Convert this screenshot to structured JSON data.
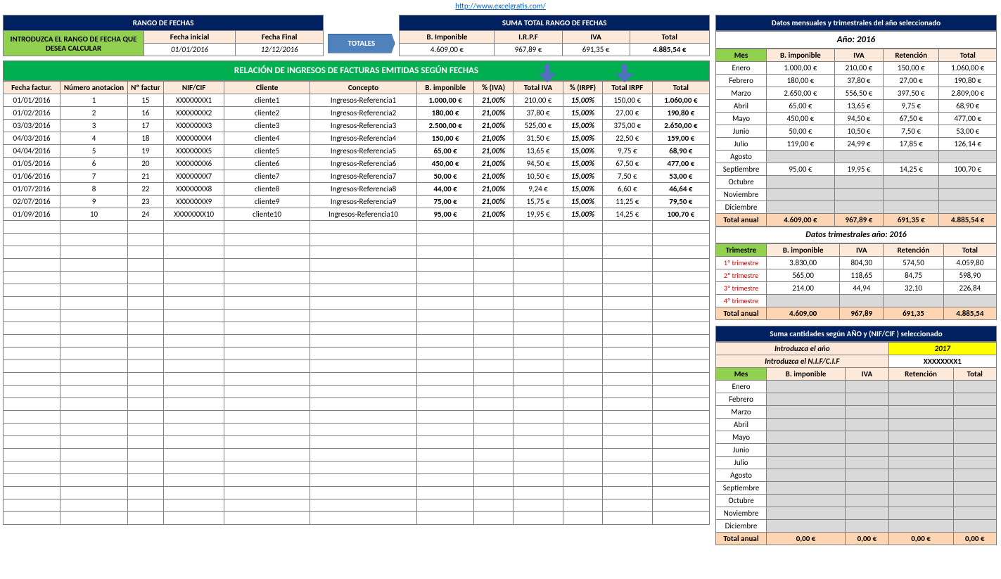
{
  "link": "http://www.excelgratis.com/",
  "rango_header": "RANGO DE FECHAS",
  "rango_instruct": "INTRODUZCA EL RANGO DE FECHA QUE DESEA CALCULAR",
  "fecha_inicial_lbl": "Fecha inicial",
  "fecha_final_lbl": "Fecha Final",
  "fecha_inicial": "01/01/2016",
  "fecha_final": "12/12/2016",
  "totales_lbl": "TOTALES",
  "suma_header": "SUMA TOTAL RANGO DE FECHAS",
  "suma_cols": [
    "B. Imponible",
    "I.R.P.F",
    "IVA",
    "Total"
  ],
  "suma_vals": [
    "4.609,00 €",
    "967,89 €",
    "691,35 €",
    "4.885,54 €"
  ],
  "relacion_title": "RELACIÓN DE INGRESOS  DE FACTURAS EMITIDAS SEGÚN FECHAS",
  "main_cols": [
    "Fecha factur.",
    "Número anotacion",
    "Nº factur",
    "NIF/CIF",
    "Cliente",
    "Concepto",
    "B. imponible",
    "% (IVA)",
    "Total IVA",
    "% (IRPF)",
    "Total IRPF",
    "Total"
  ],
  "rows": [
    {
      "f": "01/01/2016",
      "n": "1",
      "nf": "15",
      "nif": "XXXXXXXX1",
      "cl": "cliente1",
      "co": "Ingresos-Referencia1",
      "bi": "1.000,00 €",
      "pv": "21,00%",
      "tv": "210,00 €",
      "pi": "15,00%",
      "ti": "150,00 €",
      "t": "1.060,00 €"
    },
    {
      "f": "01/02/2016",
      "n": "2",
      "nf": "16",
      "nif": "XXXXXXXX2",
      "cl": "cliente2",
      "co": "Ingresos-Referencia2",
      "bi": "180,00 €",
      "pv": "21,00%",
      "tv": "37,80 €",
      "pi": "15,00%",
      "ti": "27,00 €",
      "t": "190,80 €"
    },
    {
      "f": "03/03/2016",
      "n": "3",
      "nf": "17",
      "nif": "XXXXXXXX3",
      "cl": "cliente3",
      "co": "Ingresos-Referencia3",
      "bi": "2.500,00 €",
      "pv": "21,00%",
      "tv": "525,00 €",
      "pi": "15,00%",
      "ti": "375,00 €",
      "t": "2.650,00 €"
    },
    {
      "f": "04/03/2016",
      "n": "4",
      "nf": "18",
      "nif": "XXXXXXXX4",
      "cl": "cliente4",
      "co": "Ingresos-Referencia4",
      "bi": "150,00 €",
      "pv": "21,00%",
      "tv": "31,50 €",
      "pi": "15,00%",
      "ti": "22,50 €",
      "t": "159,00 €"
    },
    {
      "f": "04/04/2016",
      "n": "5",
      "nf": "19",
      "nif": "XXXXXXXX5",
      "cl": "cliente5",
      "co": "Ingresos-Referencia5",
      "bi": "65,00 €",
      "pv": "21,00%",
      "tv": "13,65 €",
      "pi": "15,00%",
      "ti": "9,75 €",
      "t": "68,90 €"
    },
    {
      "f": "01/05/2016",
      "n": "6",
      "nf": "20",
      "nif": "XXXXXXXX6",
      "cl": "cliente6",
      "co": "Ingresos-Referencia6",
      "bi": "450,00 €",
      "pv": "21,00%",
      "tv": "94,50 €",
      "pi": "15,00%",
      "ti": "67,50 €",
      "t": "477,00 €"
    },
    {
      "f": "01/06/2016",
      "n": "7",
      "nf": "21",
      "nif": "XXXXXXXX7",
      "cl": "cliente7",
      "co": "Ingresos-Referencia7",
      "bi": "50,00 €",
      "pv": "21,00%",
      "tv": "10,50 €",
      "pi": "15,00%",
      "ti": "7,50 €",
      "t": "53,00 €"
    },
    {
      "f": "01/07/2016",
      "n": "8",
      "nf": "22",
      "nif": "XXXXXXXX8",
      "cl": "cliente8",
      "co": "Ingresos-Referencia8",
      "bi": "44,00 €",
      "pv": "21,00%",
      "tv": "9,24 €",
      "pi": "15,00%",
      "ti": "6,60 €",
      "t": "46,64 €"
    },
    {
      "f": "02/07/2016",
      "n": "9",
      "nf": "23",
      "nif": "XXXXXXXX9",
      "cl": "cliente9",
      "co": "Ingresos-Referencia9",
      "bi": "75,00 €",
      "pv": "21,00%",
      "tv": "15,75 €",
      "pi": "15,00%",
      "ti": "11,25 €",
      "t": "79,50 €"
    },
    {
      "f": "01/09/2016",
      "n": "10",
      "nf": "24",
      "nif": "XXXXXXXX10",
      "cl": "cliente10",
      "co": "Ingresos-Referencia10",
      "bi": "95,00 €",
      "pv": "21,00%",
      "tv": "19,95 €",
      "pi": "15,00%",
      "ti": "14,25 €",
      "t": "100,70 €"
    }
  ],
  "empty_rows": 24,
  "monthly_header": "Datos mensuales  y trimestrales del año seleccionado",
  "year_lbl": "Año:  2016",
  "monthly_cols": [
    "Mes",
    "B. imponible",
    "IVA",
    "Retención",
    "Total"
  ],
  "months": [
    {
      "m": "Enero",
      "bi": "1.000,00 €",
      "iva": "210,00 €",
      "ret": "150,00 €",
      "t": "1.060,00 €"
    },
    {
      "m": "Febrero",
      "bi": "180,00 €",
      "iva": "37,80 €",
      "ret": "27,00 €",
      "t": "190,80 €"
    },
    {
      "m": "Marzo",
      "bi": "2.650,00 €",
      "iva": "556,50 €",
      "ret": "397,50 €",
      "t": "2.809,00 €"
    },
    {
      "m": "Abril",
      "bi": "65,00 €",
      "iva": "13,65 €",
      "ret": "9,75 €",
      "t": "68,90 €"
    },
    {
      "m": "Mayo",
      "bi": "450,00 €",
      "iva": "94,50 €",
      "ret": "67,50 €",
      "t": "477,00 €"
    },
    {
      "m": "Junio",
      "bi": "50,00 €",
      "iva": "10,50 €",
      "ret": "7,50 €",
      "t": "53,00 €"
    },
    {
      "m": "Julio",
      "bi": "119,00 €",
      "iva": "24,99 €",
      "ret": "17,85 €",
      "t": "126,14 €"
    },
    {
      "m": "Agosto",
      "bi": "",
      "iva": "",
      "ret": "",
      "t": ""
    },
    {
      "m": "Septiembre",
      "bi": "95,00 €",
      "iva": "19,95 €",
      "ret": "14,25 €",
      "t": "100,70 €"
    },
    {
      "m": "Octubre",
      "bi": "",
      "iva": "",
      "ret": "",
      "t": ""
    },
    {
      "m": "Noviembre",
      "bi": "",
      "iva": "",
      "ret": "",
      "t": ""
    },
    {
      "m": "Diciembre",
      "bi": "",
      "iva": "",
      "ret": "",
      "t": ""
    }
  ],
  "total_anual_lbl": "Total anual",
  "monthly_total": [
    "4.609,00 €",
    "967,89 €",
    "691,35 €",
    "4.885,54 €"
  ],
  "qtr_title": "Datos trimestrales año: 2016",
  "qtr_cols": [
    "Trimestre",
    "B. imponible",
    "IVA",
    "Retención",
    "Total"
  ],
  "quarters": [
    {
      "q": "1º trimestre",
      "bi": "3.830,00",
      "iva": "804,30",
      "ret": "574,50",
      "t": "4.059,80"
    },
    {
      "q": "2º trimestre",
      "bi": "565,00",
      "iva": "118,65",
      "ret": "84,75",
      "t": "598,90"
    },
    {
      "q": "3º trimestre",
      "bi": "214,00",
      "iva": "44,94",
      "ret": "32,10",
      "t": "226,84"
    },
    {
      "q": "4º trimestre",
      "bi": "",
      "iva": "",
      "ret": "",
      "t": ""
    }
  ],
  "qtr_total": [
    "4.609,00",
    "967,89",
    "691,35",
    "4.885,54"
  ],
  "nif_header": "Suma cantidades según  AÑO y  (NIF/CIF )  seleccionado",
  "nif_year_lbl": "Introduzca  el año",
  "nif_year": "2017",
  "nif_lbl": "Introduzca el  N.I.F/C.I.F",
  "nif_val": "XXXXXXXX1",
  "nif_months": [
    "Enero",
    "Febrero",
    "Marzo",
    "Abril",
    "Mayo",
    "Junio",
    "Julio",
    "Agosto",
    "Septiembre",
    "Octubre",
    "Noviembre",
    "Diciembre"
  ],
  "nif_total": [
    "0,00 €",
    "0,00 €",
    "0,00 €",
    "0,00 €"
  ]
}
